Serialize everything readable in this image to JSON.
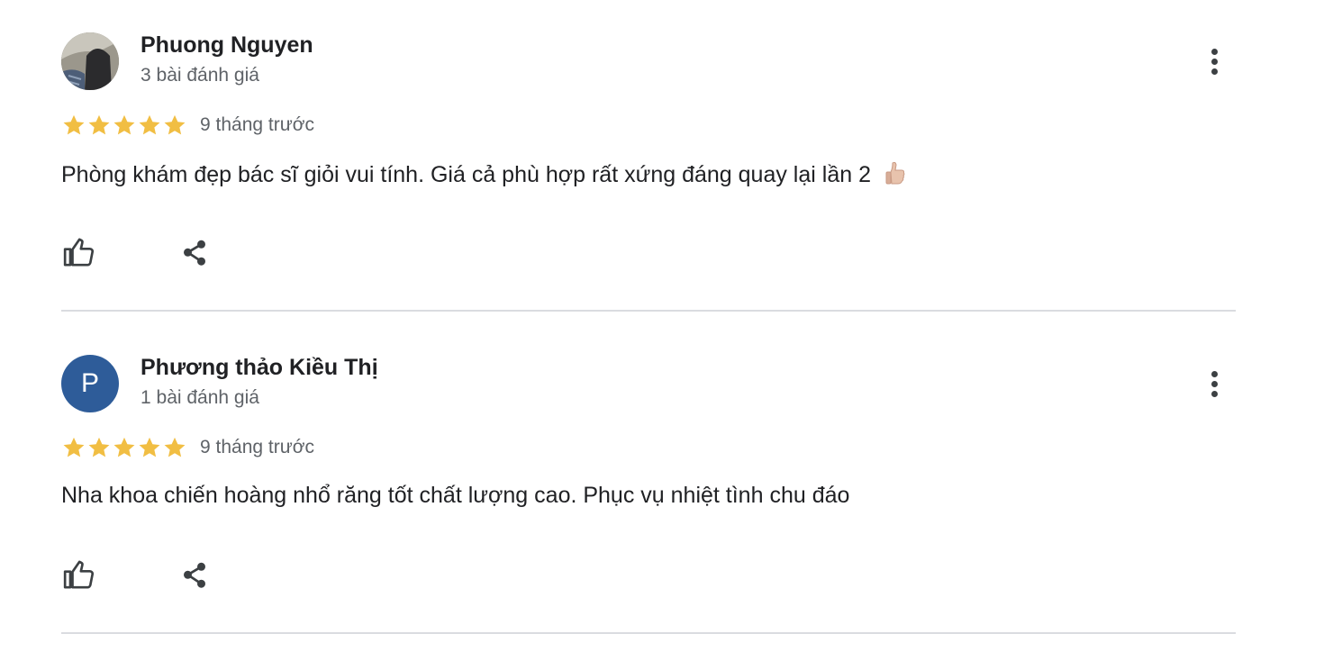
{
  "colors": {
    "star": "#F1BE43",
    "name": "#202124",
    "meta": "#5F6368",
    "divider": "#DADCE0",
    "avatar_letter_bg": "#2E5C99"
  },
  "reviews": [
    {
      "reviewer_name": "Phuong Nguyen",
      "review_count": "3 bài đánh giá",
      "avatar": "profile-photo",
      "rating": 5,
      "time": "9 tháng trước",
      "text": "Phòng khám đẹp bác sĩ giỏi vui tính. Giá cả phù hợp rất xứng đáng quay lại lần 2",
      "text_emoji": "thumbs-up-emoji",
      "actions": [
        "thumbs-up-icon",
        "share-icon"
      ],
      "menu_icon": "more-vert-icon"
    },
    {
      "reviewer_name": "Phương thảo Kiều Thị",
      "review_count": "1 bài đánh giá",
      "avatar_letter": "P",
      "rating": 5,
      "time": "9 tháng trước",
      "text": "Nha khoa chiến hoàng nhổ răng tốt chất lượng cao. Phục vụ nhiệt tình chu đáo",
      "actions": [
        "thumbs-up-icon",
        "share-icon"
      ],
      "menu_icon": "more-vert-icon"
    }
  ]
}
